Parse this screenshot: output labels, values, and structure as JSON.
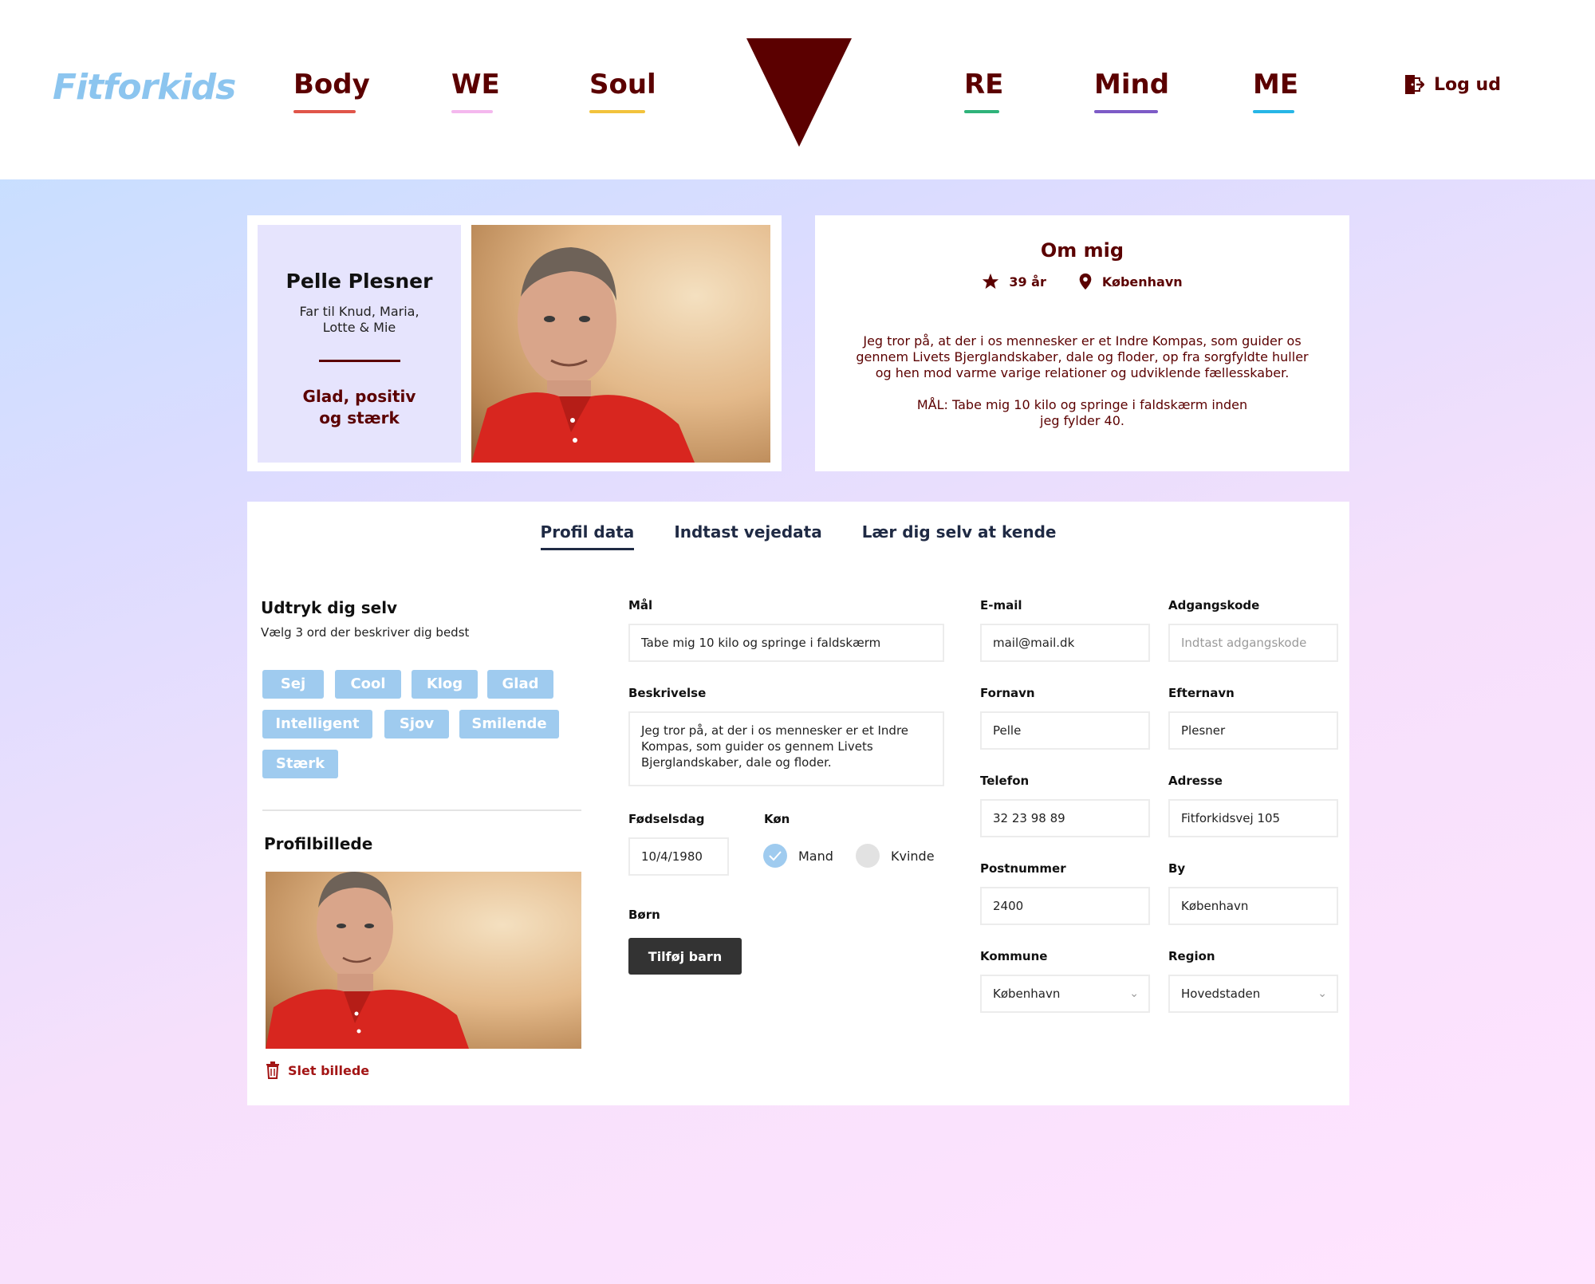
{
  "header": {
    "logo": "Fitforkids",
    "nav": [
      {
        "label": "Body",
        "color": "#e0554a"
      },
      {
        "label": "WE",
        "color": "#f4b8ee"
      },
      {
        "label": "Soul",
        "color": "#f2c33c"
      },
      {
        "label": "RE",
        "color": "#2fb37a"
      },
      {
        "label": "Mind",
        "color": "#7d5bc6"
      },
      {
        "label": "ME",
        "color": "#27b6e6"
      }
    ],
    "logout": "Log ud",
    "triangle_color": "#5b0000"
  },
  "profile": {
    "name": "Pelle Plesner",
    "subtitle": "Far til Knud, Maria, Lotte & Mie",
    "motto": "Glad, positiv og stærk"
  },
  "about": {
    "title": "Om mig",
    "age": "39 år",
    "city": "København",
    "text": "Jeg tror på, at der i os mennesker er et Indre Kompas, som guider os gennem Livets Bjerglandskaber, dale og floder, op fra sorgfyldte huller og hen mod varme varige relationer og udviklende fællesskaber.",
    "goal": "MÅL: Tabe mig 10 kilo og springe i faldskærm inden jeg fylder 40."
  },
  "tabs": [
    "Profil data",
    "Indtast vejedata",
    "Lær dig selv at kende"
  ],
  "express": {
    "title": "Udtryk dig selv",
    "subtitle": "Vælg 3 ord der beskriver dig bedst",
    "chips": [
      "Sej",
      "Cool",
      "Klog",
      "Glad",
      "Intelligent",
      "Sjov",
      "Smilende",
      "Stærk"
    ]
  },
  "profile_picture": {
    "title": "Profilbillede",
    "delete_label": "Slet billede"
  },
  "form": {
    "goal_label": "Mål",
    "goal_value": "Tabe mig 10 kilo og springe i faldskærm",
    "description_label": "Beskrivelse",
    "description_value": "Jeg tror på, at der i os mennesker er et Indre Kompas, som guider os gennem Livets Bjerglandskaber, dale og floder.",
    "birthday_label": "Fødselsdag",
    "birthday_value": "10/4/1980",
    "gender_label": "Køn",
    "gender_options": [
      "Mand",
      "Kvinde"
    ],
    "gender_selected": "Mand",
    "children_label": "Børn",
    "add_child_label": "Tilføj barn",
    "email_label": "E-mail",
    "email_value": "mail@mail.dk",
    "password_label": "Adgangskode",
    "password_placeholder": "Indtast adgangskode",
    "firstname_label": "Fornavn",
    "firstname_value": "Pelle",
    "lastname_label": "Efternavn",
    "lastname_value": "Plesner",
    "phone_label": "Telefon",
    "phone_value": "32 23 98 89",
    "address_label": "Adresse",
    "address_value": "Fitforkidsvej 105",
    "zip_label": "Postnummer",
    "zip_value": "2400",
    "city_label": "By",
    "city_value": "København",
    "municipality_label": "Kommune",
    "municipality_value": "København",
    "region_label": "Region",
    "region_value": "Hovedstaden"
  }
}
